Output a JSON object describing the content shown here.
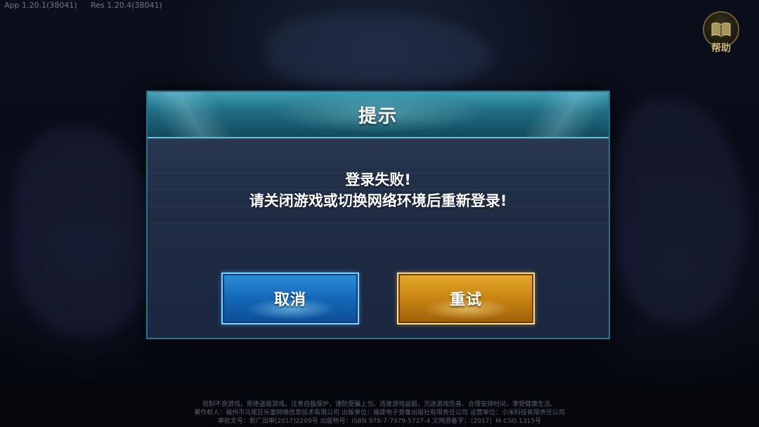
{
  "version": {
    "app": "App 1.20.1(38041)",
    "res": "Res 1.20.4(38041)"
  },
  "help": {
    "label": "帮助",
    "icon": "book-icon"
  },
  "dialog": {
    "title": "提示",
    "message_line1": "登录失败!",
    "message_line2": "请关闭游戏或切换网络环境后重新登录!",
    "cancel_label": "取消",
    "retry_label": "重试"
  },
  "footer": {
    "line1": "抵制不良游戏，拒绝盗版游戏。注意自我保护，谨防受骗上当。适度游戏益脑，沉迷游戏伤身。合理安排时间，享受健康生活。",
    "line2": "著作权人：福州市马尾区乐童网络信息技术有限公司    出版单位：福建电子音像出版社有限责任公司    运营单位：小米科技有限责任公司",
    "line3": "审批文号：新广出审[2017]2209号    出版物号：ISBN 978-7-7979-5727-4    文网游备字：〔2017〕M-CSG 1315号"
  },
  "colors": {
    "dialog_header": "#1f6a80",
    "dialog_body": "#1f2c44",
    "cancel_button": "#1567b8",
    "retry_button": "#c98414",
    "help_gold": "#c9b77d"
  }
}
